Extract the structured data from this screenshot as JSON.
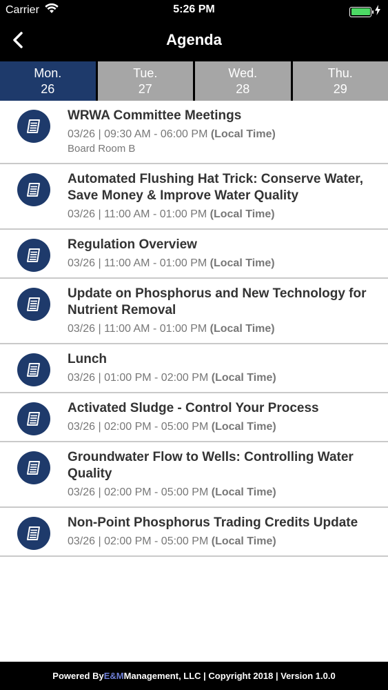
{
  "status_bar": {
    "carrier": "Carrier",
    "time": "5:26 PM",
    "battery_level": 1.0,
    "battery_color": "#4cd964"
  },
  "nav": {
    "title": "Agenda",
    "back_icon": "chevron-left-icon"
  },
  "day_tabs": [
    {
      "day": "Mon.",
      "date": "26",
      "active": true
    },
    {
      "day": "Tue.",
      "date": "27",
      "active": false
    },
    {
      "day": "Wed.",
      "date": "28",
      "active": false
    },
    {
      "day": "Thu.",
      "date": "29",
      "active": false
    }
  ],
  "sessions": [
    {
      "title": "WRWA Committee Meetings",
      "time": "03/26 | 09:30 AM - 06:00 PM",
      "time_note": "(Local Time)",
      "location": "Board Room B"
    },
    {
      "title": "Automated Flushing Hat Trick: Conserve Water, Save Money & Improve Water Quality",
      "time": "03/26 | 11:00 AM - 01:00 PM",
      "time_note": "(Local Time)"
    },
    {
      "title": "Regulation Overview",
      "time": "03/26 | 11:00 AM - 01:00 PM",
      "time_note": "(Local Time)"
    },
    {
      "title": "Update on Phosphorus and New Technology for Nutrient Removal",
      "time": "03/26 | 11:00 AM - 01:00 PM",
      "time_note": "(Local Time)"
    },
    {
      "title": "Lunch",
      "time": "03/26 | 01:00 PM - 02:00 PM",
      "time_note": "(Local Time)"
    },
    {
      "title": "Activated Sludge - Control Your Process",
      "time": "03/26 | 02:00 PM - 05:00 PM",
      "time_note": "(Local Time)"
    },
    {
      "title": "Groundwater Flow to Wells:  Controlling Water Quality",
      "time": "03/26 | 02:00 PM - 05:00 PM",
      "time_note": "(Local Time)"
    },
    {
      "title": "Non-Point Phosphorus Trading Credits Update",
      "time": "03/26 | 02:00 PM - 05:00 PM",
      "time_note": "(Local Time)"
    }
  ],
  "session_icon": "document-icon",
  "footer": {
    "prefix": "Powered By ",
    "brand": "E&M",
    "suffix": " Management, LLC | Copyright 2018 | Version 1.0.0"
  },
  "colors": {
    "accent": "#1e3a6b",
    "tab_inactive": "#a6a6a6",
    "brand": "#6f7fd6"
  }
}
